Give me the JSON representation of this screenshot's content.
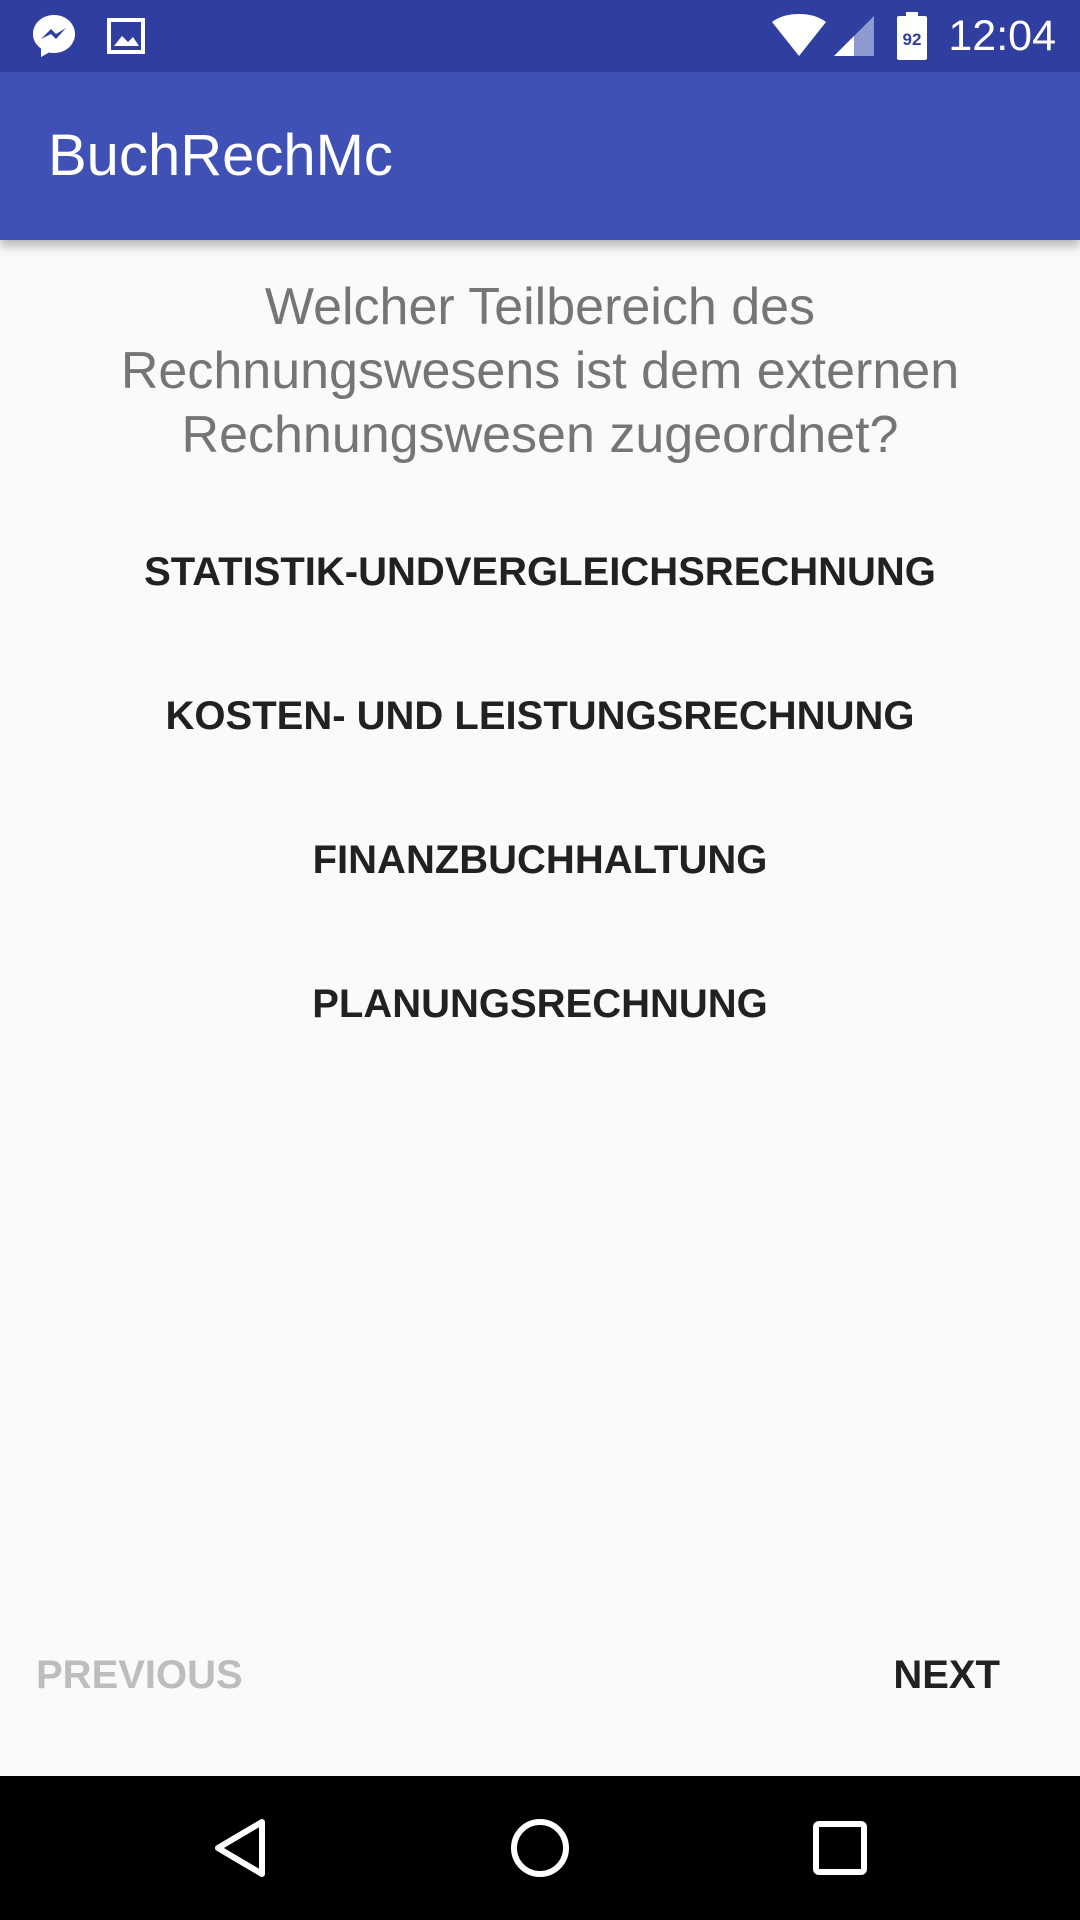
{
  "status_bar": {
    "time": "12:04",
    "battery_level": "92",
    "icons": [
      "messenger-icon",
      "image-icon",
      "wifi-icon",
      "cell-signal-icon",
      "battery-icon"
    ],
    "background": "#303f9f"
  },
  "app_bar": {
    "title": "BuchRechMc",
    "background": "#3f51b5"
  },
  "quiz": {
    "question": "Welcher Teilbereich des Rechnungswesens ist dem externen Rechnungswesen zugeordnet?",
    "answers": [
      "STATISTIK-UNDVERGLEICHSRECHNUNG",
      "KOSTEN- UND LEISTUNGSRECHNUNG",
      "FINANZBUCHHALTUNG",
      "PLANUNGSRECHNUNG"
    ]
  },
  "navigation": {
    "previous_label": "PREVIOUS",
    "next_label": "NEXT",
    "previous_enabled": false,
    "next_enabled": true
  },
  "system_nav": {
    "keys": [
      "back-icon",
      "home-icon",
      "recents-icon"
    ]
  }
}
